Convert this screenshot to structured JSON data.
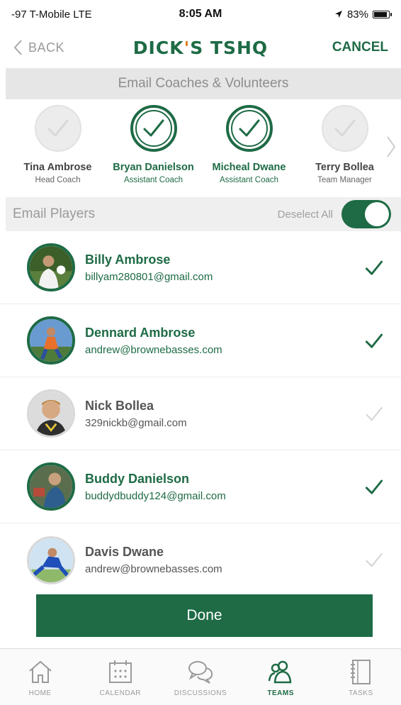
{
  "status_bar": {
    "carrier": "-97 T-Mobile  LTE",
    "time": "8:05 AM",
    "battery": "83%",
    "battery_level": 0.83
  },
  "nav": {
    "back_label": "BACK",
    "logo_part1": "DICK",
    "logo_apos": "'",
    "logo_part2": "S TSHQ",
    "cancel_label": "CANCEL"
  },
  "coaches_section": {
    "title": "Email Coaches & Volunteers",
    "coaches": [
      {
        "name": "Tina Ambrose",
        "role": "Head Coach",
        "selected": false
      },
      {
        "name": "Bryan Danielson",
        "role": "Assistant Coach",
        "selected": true
      },
      {
        "name": "Micheal Dwane",
        "role": "Assistant Coach",
        "selected": true
      },
      {
        "name": "Terry Bollea",
        "role": "Team Manager",
        "selected": false
      }
    ]
  },
  "players_section": {
    "title": "Email Players",
    "deselect_label": "Deselect All",
    "players": [
      {
        "name": "Billy Ambrose",
        "email": "billyam280801@gmail.com",
        "selected": true
      },
      {
        "name": "Dennard Ambrose",
        "email": "andrew@brownebasses.com",
        "selected": true
      },
      {
        "name": "Nick Bollea",
        "email": "329nickb@gmail.com",
        "selected": false
      },
      {
        "name": "Buddy Danielson",
        "email": "buddydbuddy124@gmail.com",
        "selected": true
      },
      {
        "name": "Davis Dwane",
        "email": "andrew@brownebasses.com",
        "selected": false
      }
    ]
  },
  "done_label": "Done",
  "tabs": [
    {
      "label": "HOME",
      "icon": "home-icon",
      "active": false
    },
    {
      "label": "CALENDAR",
      "icon": "calendar-icon",
      "active": false
    },
    {
      "label": "DISCUSSIONS",
      "icon": "discussions-icon",
      "active": false
    },
    {
      "label": "TEAMS",
      "icon": "teams-icon",
      "active": true
    },
    {
      "label": "TASKS",
      "icon": "tasks-icon",
      "active": false
    }
  ],
  "colors": {
    "brand_green": "#1e6b45",
    "logo_accent": "#e07a1f",
    "inactive_gray": "#d4d4d4"
  }
}
